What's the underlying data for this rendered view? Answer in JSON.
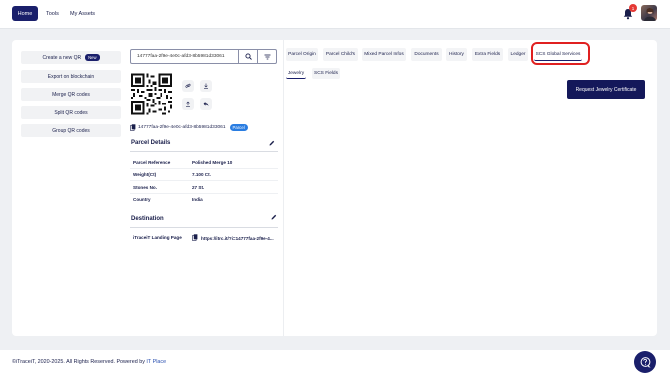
{
  "nav": {
    "home": "Home",
    "tools": "Tools",
    "my_assets": "My Assets",
    "notification_count": "1"
  },
  "sidebar": {
    "create_label": "Create a new QR",
    "new_badge": "New",
    "export": "Export on blockchain",
    "merge": "Merge QR codes",
    "split": "Split QR codes",
    "group": "Group QR codes"
  },
  "search": {
    "value": "14777faa-2f9e-4e0c-afd3-8b5981d33061"
  },
  "parcel": {
    "code": "14777faa-2f9e-4e0c-afd3-8b5981d33061",
    "badge": "Parcel"
  },
  "parcel_details": {
    "title": "Parcel Details",
    "rows": [
      {
        "label": "Parcel Reference",
        "value": "Polished Merge 10"
      },
      {
        "label": "Weight(Ct)",
        "value": "7.100 Ct."
      },
      {
        "label": "Stones No.",
        "value": "27 St."
      },
      {
        "label": "Country",
        "value": "India"
      }
    ]
  },
  "destination": {
    "title": "Destination",
    "label": "iTraceiT Landing Page",
    "url": "https://itrc.it/?i=14777faa-2f9e-4..."
  },
  "tabs": [
    "Parcel Origin",
    "Parcel Child's",
    "Mixed Parcel Infos",
    "Documents",
    "History",
    "Extra Fields",
    "Ledger",
    "SCS Global Services"
  ],
  "subtabs": [
    "Jewelry",
    "SCS Fields"
  ],
  "request_button": "Request Jewelry Certificate",
  "footer": {
    "copyright": "©iTraceiT, 2020-2025. All Rights Reserved. Powered by ",
    "company": "IT Place"
  },
  "colors": {
    "brand": "#1a1f6b",
    "badge": "#2a7de1",
    "highlight": "#e02020"
  }
}
